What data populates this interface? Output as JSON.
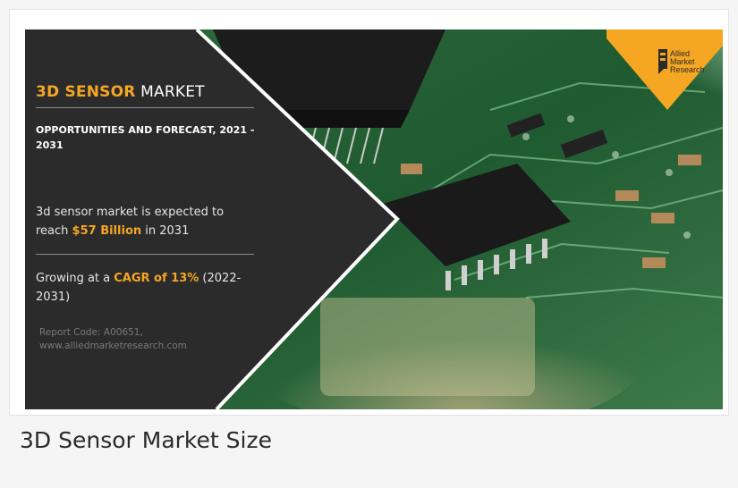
{
  "banner": {
    "title_accent": "3D SENSOR",
    "title_rest": " MARKET",
    "subtitle": "OPPORTUNITIES AND FORECAST, 2021 - 2031",
    "stat1_prefix": "3d sensor market is expected to reach ",
    "stat1_highlight": "$57 Billion",
    "stat1_suffix": " in 2031",
    "stat2_prefix": "Growing at a ",
    "stat2_highlight": "CAGR of 13%",
    "stat2_suffix": " (2022-2031)",
    "report_line1": "Report Code: A00651,",
    "report_line2": "www.alliedmarketresearch.com",
    "logo_line1": "Allied",
    "logo_line2": "Market",
    "logo_line3": "Research"
  },
  "caption": "3D Sensor Market Size",
  "colors": {
    "accent": "#f5a623",
    "panel": "#2b2b2c",
    "pcb_green": "#1f6b3a"
  }
}
